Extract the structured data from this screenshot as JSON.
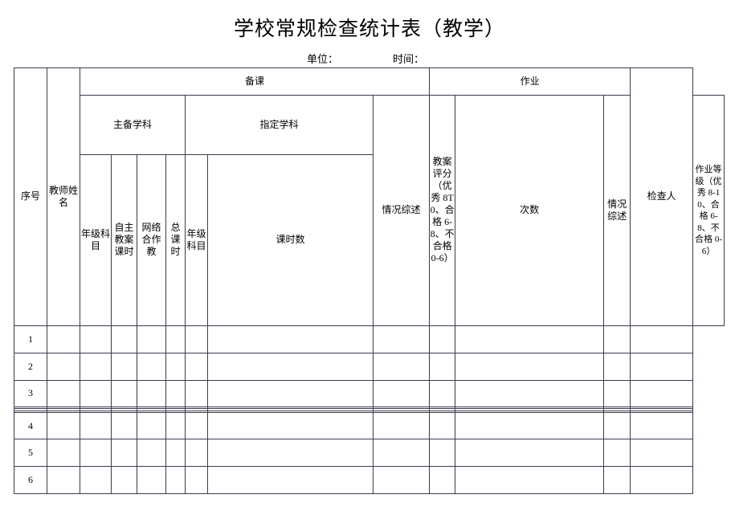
{
  "document": {
    "title": "学校常规检查统计表（教学）",
    "unit_label": "单位：",
    "time_label": "时间："
  },
  "table": {
    "group_headers": {
      "seq": "序号",
      "teacher_name": "教师姓名",
      "prepare": "备课",
      "homework": "作业",
      "inspector": "检查人"
    },
    "sub_group_headers": {
      "main_subject": "主备学科",
      "assigned_subject": "指定学科"
    },
    "columns": {
      "main_grade_subject": "年级科目",
      "self_lesson_plan_hours": "自主教案课时",
      "network_cooperative_teaching": "网络合作教",
      "total_hours": "总课时",
      "assigned_grade_subject": "年级科目",
      "assigned_hours": "课时数",
      "prepare_summary": "情况综述",
      "plan_score": "教案评分（优秀 8T0、合格 6-8、不合格 0-6）",
      "homework_count": "次数",
      "homework_summary": "情况综述",
      "homework_grade": "作业等级（优秀 8-10、合格 6-8、不合格 0-6）"
    },
    "rows": [
      {
        "seq": "1"
      },
      {
        "seq": "2"
      },
      {
        "seq": "3"
      },
      {
        "seq": ""
      },
      {
        "seq": ""
      },
      {
        "seq": ""
      },
      {
        "seq": "4"
      },
      {
        "seq": "5"
      },
      {
        "seq": "6"
      }
    ]
  },
  "style": {
    "border_color": "#3b3b4f",
    "text_color": "#000000",
    "background": "#ffffff"
  }
}
